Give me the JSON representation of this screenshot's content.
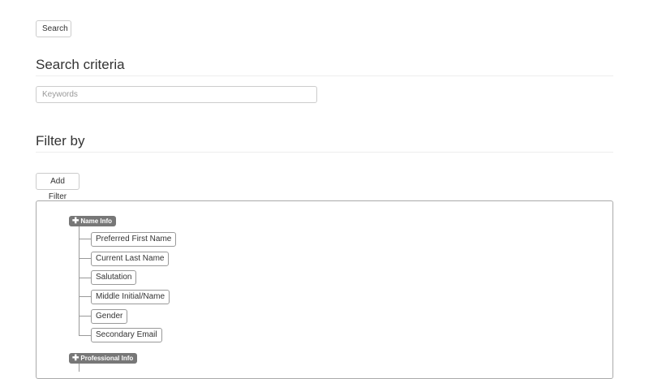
{
  "toolbar": {
    "search_label": "Search"
  },
  "search_criteria": {
    "title": "Search criteria",
    "keywords_placeholder": "Keywords",
    "keywords_value": ""
  },
  "filter": {
    "title": "Filter by",
    "add_filter_label": "Add Filter",
    "groups": [
      {
        "label": "Name Info",
        "expand_icon": "plus-icon",
        "items": [
          "Preferred First Name",
          "Current Last Name",
          "Salutation",
          "Middle Initial/Name",
          "Gender",
          "Secondary Email"
        ]
      },
      {
        "label": "Professional Info",
        "expand_icon": "plus-icon",
        "items": []
      }
    ]
  }
}
